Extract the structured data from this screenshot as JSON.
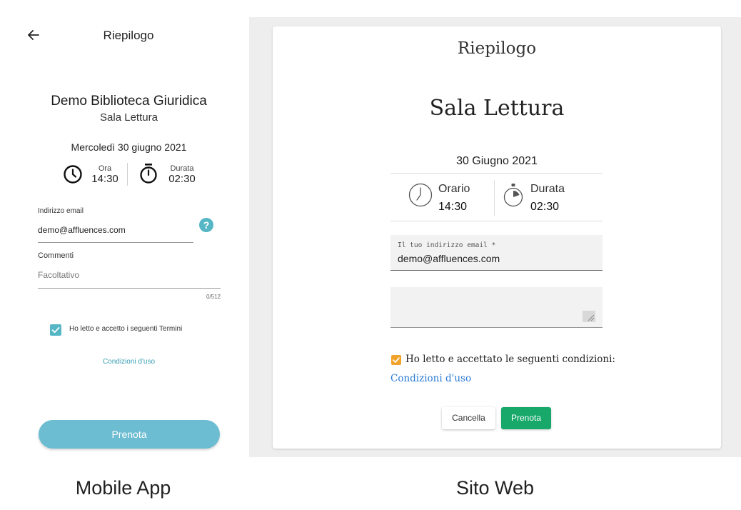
{
  "mobile": {
    "header": {
      "back_icon": "arrow-left-icon",
      "title": "Riepilogo"
    },
    "library_name": "Demo Biblioteca Giuridica",
    "room_name": "Sala Lettura",
    "date": "Mercoledì 30 giugno 2021",
    "time": {
      "icon": "clock-icon",
      "label": "Ora",
      "value": "14:30"
    },
    "duration": {
      "icon": "stopwatch-icon",
      "label": "Durata",
      "value": "02:30"
    },
    "email": {
      "label": "Indirizzo email",
      "value": "demo@affluences.com",
      "help_icon": "question-icon",
      "help_symbol": "?"
    },
    "comments": {
      "label": "Commenti",
      "placeholder": "Facoltativo",
      "counter": "0/512"
    },
    "terms_checkbox": {
      "checked": true,
      "label": "Ho letto e accetto i seguenti Termini"
    },
    "terms_link": "Condizioni d'uso",
    "book_button": "Prenota",
    "colors": {
      "accent": "#55b6c6",
      "button": "#6cbcd2"
    }
  },
  "web": {
    "title": "Riepilogo",
    "room_name": "Sala Lettura",
    "date": "30 Giugno 2021",
    "time": {
      "icon": "clock-icon",
      "label": "Orario",
      "value": "14:30"
    },
    "duration": {
      "icon": "stopwatch-icon",
      "label": "Durata",
      "value": "02:30"
    },
    "email": {
      "label": "Il tuo indirizzo email *",
      "value": "demo@affluences.com"
    },
    "comments": {
      "value": ""
    },
    "terms_checkbox": {
      "checked": true,
      "label": "Ho letto e accettato le seguenti condizioni:"
    },
    "terms_link": "Condizioni d'uso",
    "cancel_button": "Cancella",
    "book_button": "Prenota",
    "colors": {
      "checkbox": "#f0a22b",
      "book": "#17a86a",
      "link": "#2a7bd6"
    }
  },
  "captions": {
    "mobile": "Mobile App",
    "web": "Sito Web"
  }
}
